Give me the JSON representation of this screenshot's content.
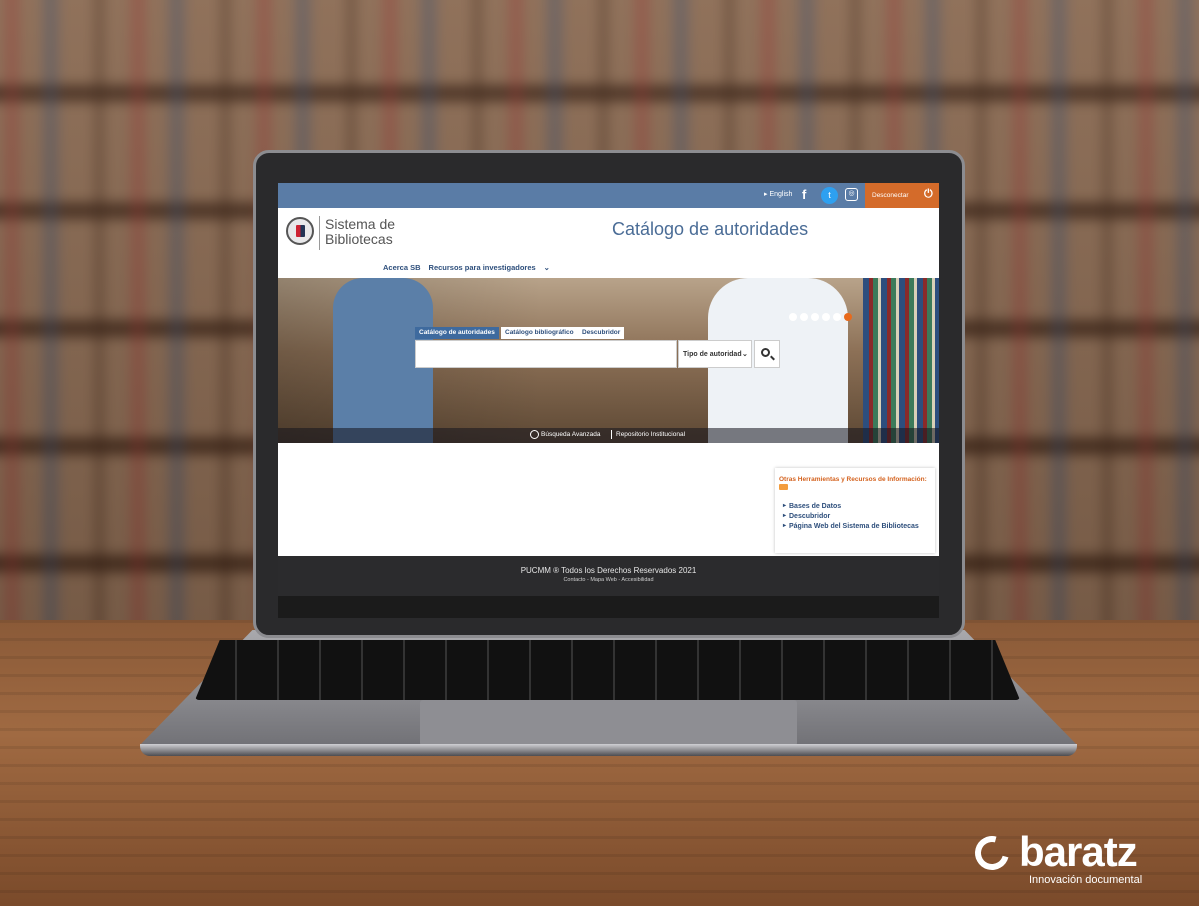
{
  "topbar": {
    "language": "▸ English",
    "facebook_icon": "facebook-icon",
    "twitter_icon": "twitter-icon",
    "instagram_icon": "instagram-icon",
    "logout_label": "Desconectar",
    "logout_icon": "power-icon"
  },
  "header": {
    "org_name": "Sistema de Bibliotecas",
    "page_title": "Catálogo de autoridades"
  },
  "nav": {
    "items": [
      "Acerca SB",
      "Recursos para investigadores"
    ]
  },
  "hero": {
    "slides_total": 6,
    "active_slide": 6
  },
  "search": {
    "tabs": [
      "Catálogo de autoridades",
      "Catálogo bibliográfico",
      "Descubridor"
    ],
    "active_tab": "Catálogo de autoridades",
    "input_value": "",
    "type_select": "Tipo de autoridad",
    "advanced_link": "Búsqueda Avanzada",
    "repository_link": "Repositorio Institucional"
  },
  "sidebar": {
    "title": "Otras Herramientas y Recursos de Información:",
    "links": [
      "Bases de Datos",
      "Descubridor",
      "Página Web del Sistema de Bibliotecas"
    ]
  },
  "footer": {
    "rights": "PUCMM ® Todos los Derechos Reservados 2021",
    "links": "Contacto - Mapa Web - Accesibilidad"
  },
  "watermark": {
    "brand": "baratz",
    "tagline": "Innovación documental"
  },
  "colors": {
    "topbar": "#5a7ca6",
    "accent_orange": "#d46b2a",
    "title_blue": "#4a6c96",
    "footer": "#2b2b2d"
  }
}
